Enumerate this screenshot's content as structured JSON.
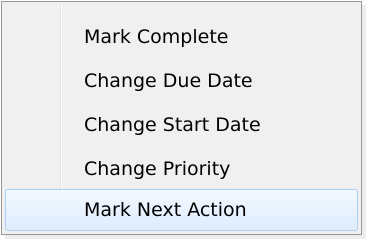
{
  "context_menu": {
    "items": [
      {
        "label": "Mark Complete",
        "highlighted": false
      },
      {
        "label": "Change Due Date",
        "highlighted": false
      },
      {
        "label": "Change Start Date",
        "highlighted": false
      },
      {
        "label": "Change Priority",
        "highlighted": false
      },
      {
        "label": "Mark Next Action",
        "highlighted": true
      }
    ]
  },
  "colors": {
    "menu_background": "#f0f0f0",
    "menu_border": "#979797",
    "highlight_border": "#aecff7",
    "highlight_fill": "#dfedfd"
  }
}
